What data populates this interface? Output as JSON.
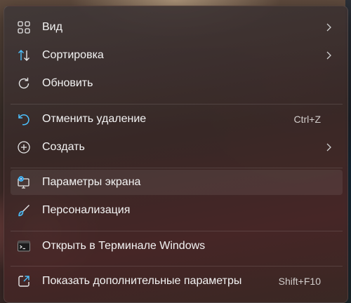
{
  "context_menu": {
    "items": [
      {
        "id": "view",
        "label": "Вид",
        "icon": "view-grid-icon",
        "has_submenu": true
      },
      {
        "id": "sort",
        "label": "Сортировка",
        "icon": "sort-arrows-icon",
        "has_submenu": true
      },
      {
        "id": "refresh",
        "label": "Обновить",
        "icon": "refresh-icon"
      },
      {
        "id": "undo",
        "label": "Отменить удаление",
        "icon": "undo-icon",
        "shortcut": "Ctrl+Z"
      },
      {
        "id": "new",
        "label": "Создать",
        "icon": "plus-circle-icon",
        "has_submenu": true
      },
      {
        "id": "display",
        "label": "Параметры экрана",
        "icon": "display-settings-icon",
        "hovered": true
      },
      {
        "id": "personalize",
        "label": "Персонализация",
        "icon": "brush-icon"
      },
      {
        "id": "terminal",
        "label": "Открыть в Терминале Windows",
        "icon": "terminal-icon"
      },
      {
        "id": "more",
        "label": "Показать дополнительные параметры",
        "icon": "open-external-icon",
        "shortcut": "Shift+F10"
      }
    ]
  },
  "colors": {
    "accent": "#4cc2ff",
    "text": "#f3f3f3",
    "shortcut_text": "#d2cdcb"
  }
}
